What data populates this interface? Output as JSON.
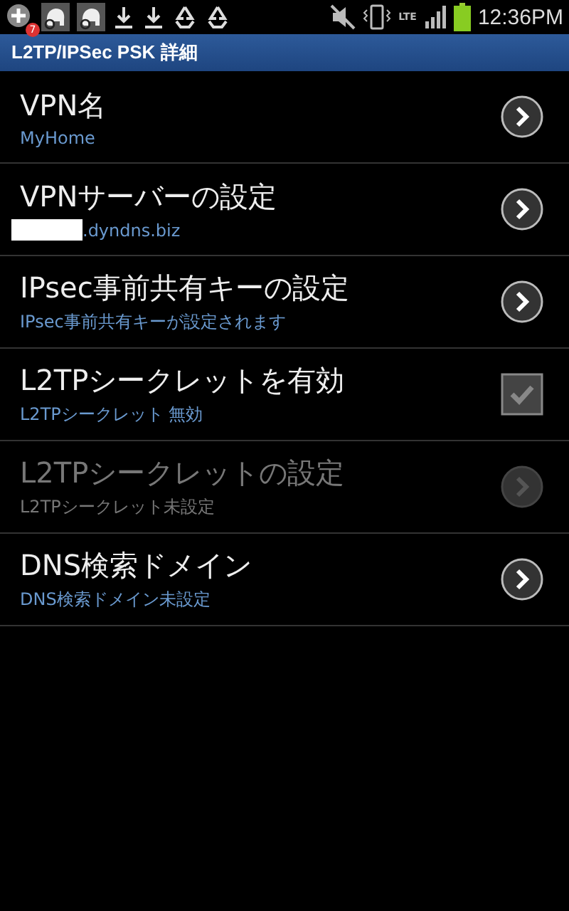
{
  "status_bar": {
    "time": "12:36PM",
    "notification_count": "7",
    "network": "LTE"
  },
  "title_bar": {
    "title": "L2TP/IPSec PSK 詳細"
  },
  "settings": [
    {
      "kind": "link",
      "title": "VPN名",
      "summary": "MyHome",
      "disabled": false,
      "redacted": false
    },
    {
      "kind": "link",
      "title": "VPNサーバーの設定",
      "summary": ".dyndns.biz",
      "disabled": false,
      "redacted": true
    },
    {
      "kind": "link",
      "title": "IPsec事前共有キーの設定",
      "summary": "IPsec事前共有キーが設定されます",
      "disabled": false,
      "redacted": false
    },
    {
      "kind": "checkbox",
      "title": "L2TPシークレットを有効",
      "summary": "L2TPシークレット 無効",
      "disabled": false,
      "checked": false,
      "redacted": false
    },
    {
      "kind": "link",
      "title": "L2TPシークレットの設定",
      "summary": "L2TPシークレット未設定",
      "disabled": true,
      "redacted": false
    },
    {
      "kind": "link",
      "title": "DNS検索ドメイン",
      "summary": "DNS検索ドメイン未設定",
      "disabled": false,
      "redacted": false
    }
  ]
}
